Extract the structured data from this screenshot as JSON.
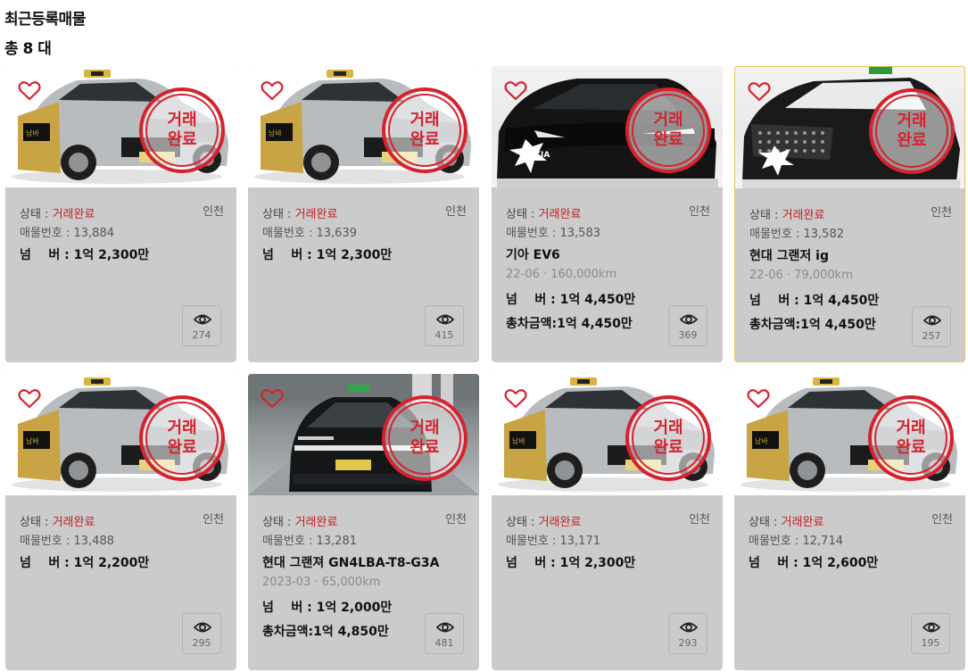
{
  "header": {
    "title": "최근등록매물",
    "count": "총 8 대"
  },
  "labels": {
    "status": "상태 : ",
    "number": "매물번호 : ",
    "number_prefix": "매물번호 : ",
    "sold_stamp_top": "거래",
    "sold_stamp_bottom": "완료",
    "price": "넘    버 : ",
    "total": "총차금액: "
  },
  "colors": {
    "card_bg": "#cbcbcb",
    "status_red": "#c41c26",
    "stamp_red": "#d6222e",
    "selected_border": "#e6c35a"
  },
  "listings": [
    {
      "status": "거래완료",
      "region": "인천",
      "number": "13,884",
      "model": "",
      "meta": "",
      "price": "1억 2,300만",
      "total": "",
      "views": "274",
      "image": "sonata-taxi"
    },
    {
      "status": "거래완료",
      "region": "인천",
      "number": "13,639",
      "model": "",
      "meta": "",
      "price": "1억 2,300만",
      "total": "",
      "views": "415",
      "image": "sonata-taxi"
    },
    {
      "status": "거래완료",
      "region": "인천",
      "number": "13,583",
      "model": "기아 EV6",
      "meta": "22-06 · 160,000km",
      "price": "1억 4,450만",
      "total": "1억 4,450만",
      "views": "369",
      "image": "ev6-black"
    },
    {
      "status": "거래완료",
      "region": "인천",
      "number": "13,582",
      "model": "현대 그랜저 ig",
      "meta": "22-06 · 79,000km",
      "price": "1억 4,450만",
      "total": "1억 4,450만",
      "views": "257",
      "image": "grandeur-black",
      "selected": true
    },
    {
      "status": "거래완료",
      "region": "인천",
      "number": "13,488",
      "model": "",
      "meta": "",
      "price": "1억 2,200만",
      "total": "",
      "views": "295",
      "image": "sonata-taxi"
    },
    {
      "status": "거래완료",
      "region": "인천",
      "number": "13,281",
      "model": "현대 그랜져 GN4LBA-T8-G3A",
      "meta": "2023-03 · 65,000km",
      "price": "1억 2,000만",
      "total": "1억 4,850만",
      "views": "481",
      "image": "grandeur-garage"
    },
    {
      "status": "거래완료",
      "region": "인천",
      "number": "13,171",
      "model": "",
      "meta": "",
      "price": "1억 2,300만",
      "total": "",
      "views": "293",
      "image": "sonata-taxi"
    },
    {
      "status": "거래완료",
      "region": "인천",
      "number": "12,714",
      "model": "",
      "meta": "",
      "price": "1억 2,600만",
      "total": "",
      "views": "195",
      "image": "sonata-taxi"
    }
  ]
}
